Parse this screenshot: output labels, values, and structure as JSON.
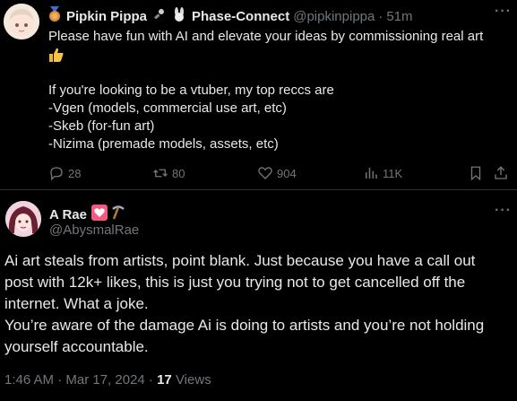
{
  "post1": {
    "display_name": "Pipkin Pippa",
    "name_suffix": "Phase-Connect",
    "handle": "@pipkinpippa",
    "separator": "·",
    "time": "51m",
    "more": "···",
    "text_lines": [
      "Please have fun with AI and elevate your ideas by commissioning real art",
      "",
      "",
      "If you're looking to be a vtuber, my top reccs are",
      "-Vgen (models, commercial use art, etc)",
      "-Skeb (for-fun art)",
      "-Nizima (premade models, assets, etc)"
    ],
    "actions": {
      "replies": "28",
      "reposts": "80",
      "likes": "904",
      "views": "11K"
    }
  },
  "post2": {
    "display_name": "A Rae",
    "handle": "@AbysmalRae",
    "more": "···",
    "text_lines": [
      "Ai art steals from artists, point blank. Just because you have a call out",
      "post with 12k+ likes, this is just you trying not to get cancelled off the",
      "internet. What a joke.",
      "You’re aware of the damage Ai is doing to artists and you’re not holding",
      "yourself accountable."
    ],
    "timestamp": "1:46 AM · Mar 17, 2024 · ",
    "views_count": "17",
    "views_label": " Views"
  },
  "colors": {
    "background": "#000000",
    "text": "#e7e9ea",
    "muted": "#71767b",
    "divider": "#2f3336"
  },
  "icons": [
    "medal-icon",
    "microphone-icon",
    "rabbit-icon",
    "thumbs-up-icon",
    "reply-icon",
    "repost-icon",
    "like-icon",
    "views-icon",
    "bookmark-icon",
    "share-icon",
    "heart-emoji-icon",
    "pickaxe-icon"
  ]
}
